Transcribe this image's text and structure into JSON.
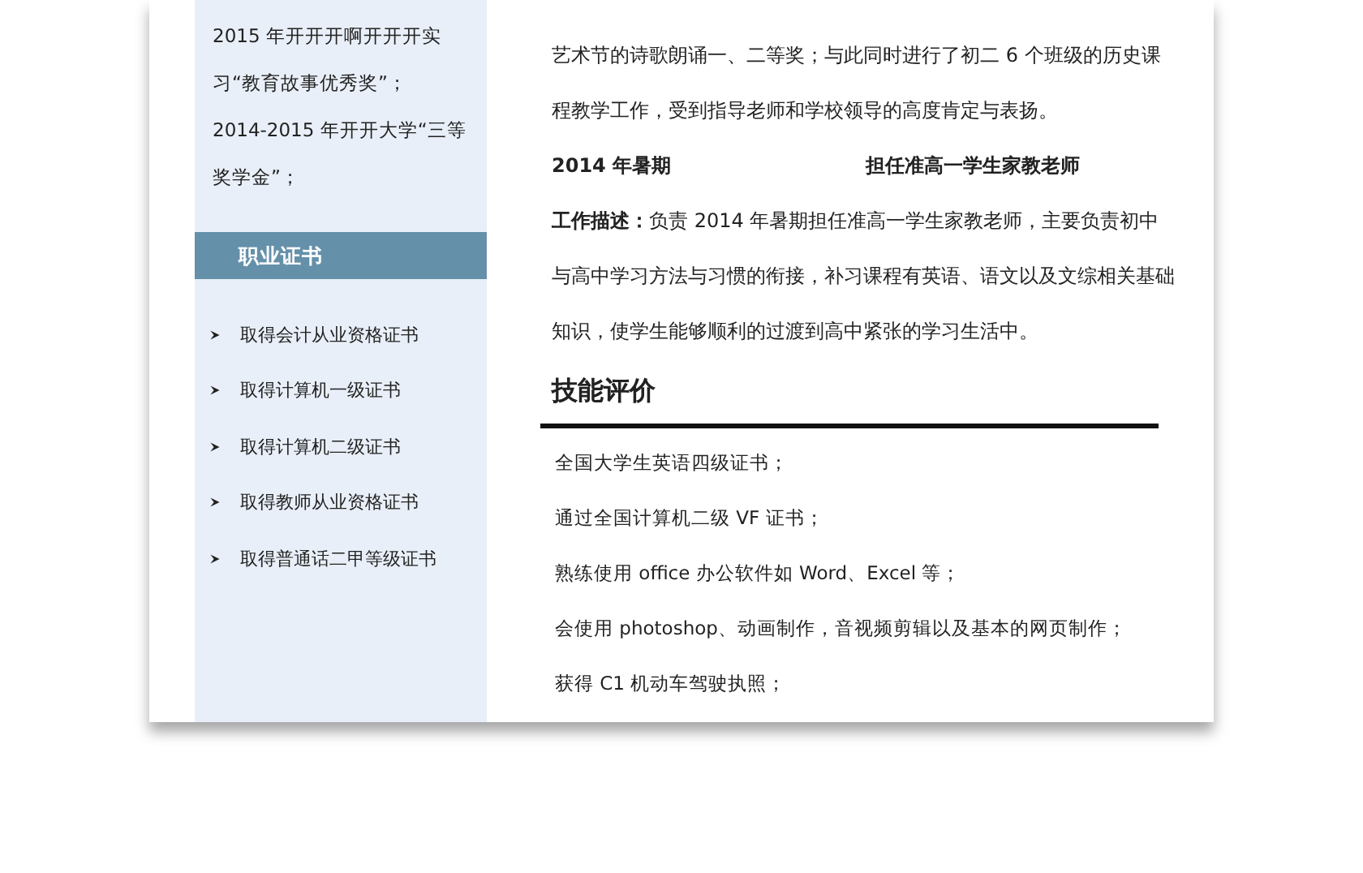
{
  "awards": [
    "2015 年开开开啊开开开实习“教育故事优秀奖”；",
    "2014-2015 年开开大学“三等奖学金”；"
  ],
  "certificates": {
    "title": "职业证书",
    "items": [
      "取得会计从业资格证书",
      "取得计算机一级证书",
      "取得计算机二级证书",
      "取得教师从业资格证书",
      "取得普通话二甲等级证书"
    ]
  },
  "experience": {
    "paragraph": "艺术节的诗歌朗诵一、二等奖；与此同时进行了初二 6 个班级的历史课程教学工作，受到指导老师和学校领导的高度肯定与表扬。",
    "job": {
      "period": "2014 年暑期",
      "role": "担任准高一学生家教老师",
      "description": "**工作描述：**负责 2014 年暑期担任准高一学生家教老师，主要负责初中与高中学习方法与习惯的衔接，补习课程有英语、语文以及文综相关基础知识，使学生能够顺利的过渡到高中紧张的学习生活中。"
    }
  },
  "skills": {
    "title": "技能评价",
    "items": [
      "全国大学生英语四级证书；",
      "通过全国计算机二级 VF 证书；",
      "熟练使用 office 办公软件如 Word、Excel 等；",
      "会使用 photoshop、动画制作，音视频剪辑以及基本的网页制作；",
      "获得 C1 机动车驾驶执照；"
    ]
  }
}
